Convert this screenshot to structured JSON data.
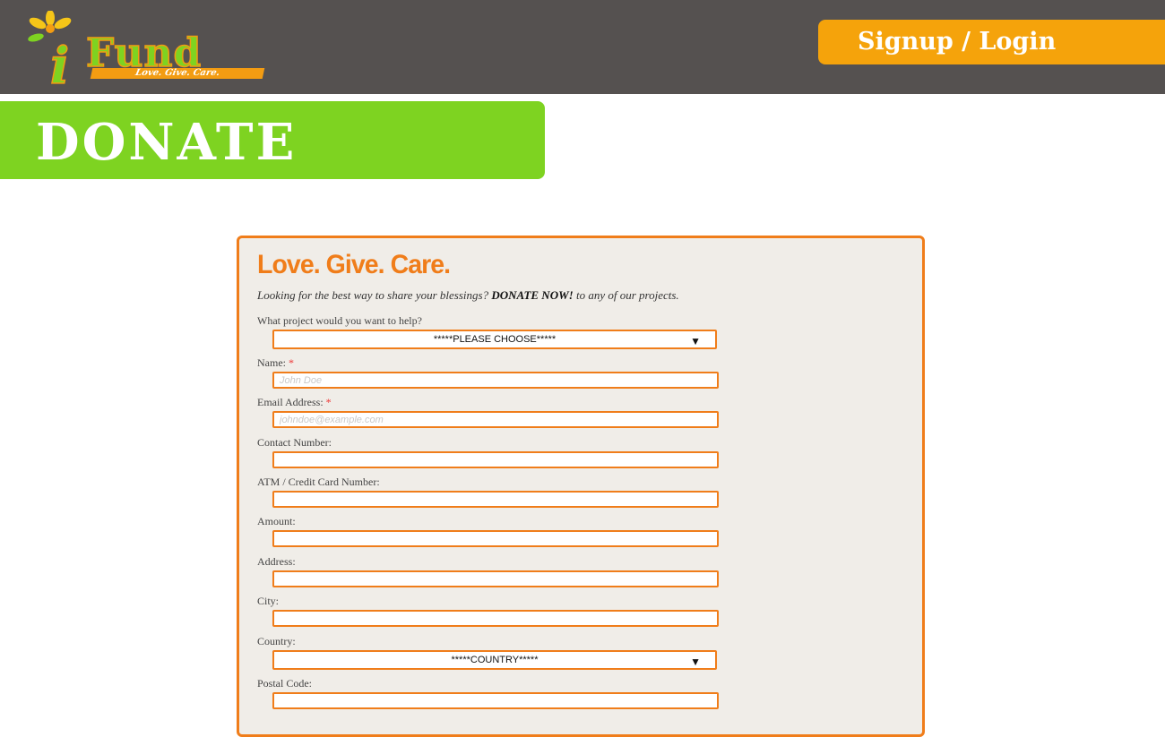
{
  "header": {
    "logo_letter": "i",
    "logo_word": "Fund",
    "logo_tagline": "Love. Give. Care.",
    "signup_label": "Signup / Login",
    "bar_color": "#555150",
    "accent": "#f5a30b"
  },
  "banner": {
    "title": "DONATE",
    "color": "#7ed321"
  },
  "form": {
    "heading": "Love. Give. Care.",
    "intro_before": "Looking for the best way to share your blessings? ",
    "intro_bold": "DONATE NOW!",
    "intro_after": " to any of our projects.",
    "project_label": "What project would you want to help?",
    "project_selected": "*****PLEASE CHOOSE*****",
    "name_label": "Name:",
    "name_placeholder": "John Doe",
    "email_label": "Email Address:",
    "email_placeholder": "johndoe@example.com",
    "required_mark": "*",
    "contact_label": "Contact Number:",
    "card_label": "ATM / Credit Card Number:",
    "amount_label": "Amount:",
    "address_label": "Address:",
    "city_label": "City:",
    "country_label": "Country:",
    "country_selected": "*****COUNTRY*****",
    "postal_label": "Postal Code:",
    "arrow": "▼",
    "border_color": "#f07d1a"
  }
}
